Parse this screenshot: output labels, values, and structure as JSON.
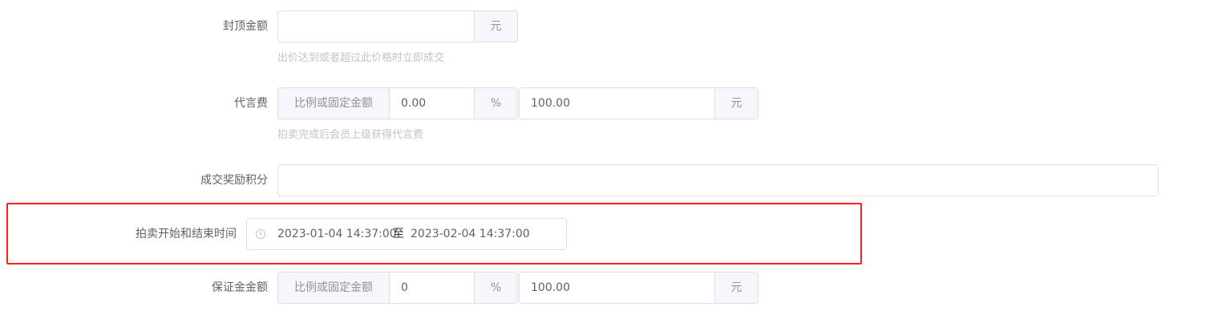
{
  "form": {
    "cap_amount": {
      "label": "封顶金额",
      "value": "",
      "unit": "元",
      "hint": "出价达到或者超过此价格时立即成交"
    },
    "commission": {
      "label": "代言费",
      "mode_label": "比例或固定金额",
      "ratio_value": "0.00",
      "ratio_unit": "%",
      "fixed_value": "100.00",
      "fixed_unit": "元",
      "hint": "拍卖完成后会员上级获得代言费"
    },
    "reward_points": {
      "label": "成交奖励积分",
      "value": ""
    },
    "auction_time": {
      "label": "拍卖开始和结束时间",
      "start": "2023-01-04 14:37:00",
      "separator": "至",
      "end": "2023-02-04 14:37:00",
      "icon": "clock-icon"
    },
    "deposit": {
      "label": "保证金金额",
      "mode_label": "比例或固定金额",
      "ratio_value": "0",
      "ratio_unit": "%",
      "fixed_value": "100.00",
      "fixed_unit": "元"
    }
  },
  "colors": {
    "highlight_border": "#ff1e1e",
    "border": "#dcdfe6",
    "addon_bg": "#f5f7fa",
    "hint_text": "#c0c4cc",
    "label_text": "#606266"
  }
}
